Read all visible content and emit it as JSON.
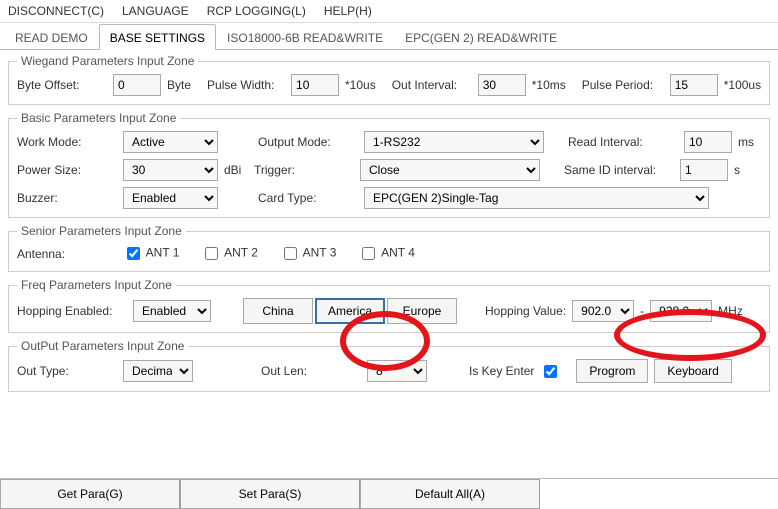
{
  "menu": {
    "disconnect": "DISCONNECT(C)",
    "language": "LANGUAGE",
    "rcplogging": "RCP LOGGING(L)",
    "help": "HELP(H)"
  },
  "tabs": {
    "readdemo": "READ DEMO",
    "basesettings": "BASE SETTINGS",
    "iso": "ISO18000-6B READ&WRITE",
    "epc": "EPC(GEN 2) READ&WRITE"
  },
  "wiegand": {
    "legend": "Wiegand Parameters Input Zone",
    "byteoffset_lbl": "Byte Offset:",
    "byteoffset": "0",
    "byte_unit": "Byte",
    "pulsewidth_lbl": "Pulse Width:",
    "pulsewidth": "10",
    "pw_unit": "*10us",
    "outinterval_lbl": "Out Interval:",
    "outinterval": "30",
    "oi_unit": "*10ms",
    "pulseperiod_lbl": "Pulse Period:",
    "pulseperiod": "15",
    "pp_unit": "*100us"
  },
  "basic": {
    "legend": "Basic Parameters Input Zone",
    "workmode_lbl": "Work Mode:",
    "workmode": "Active",
    "outputmode_lbl": "Output Mode:",
    "outputmode": "1-RS232",
    "readinterval_lbl": "Read Interval:",
    "readinterval": "10",
    "ri_unit": "ms",
    "powersize_lbl": "Power Size:",
    "powersize": "30",
    "dbi": "dBi",
    "trigger_lbl": "Trigger:",
    "trigger": "Close",
    "sameid_lbl": "Same ID interval:",
    "sameid": "1",
    "sid_unit": "s",
    "buzzer_lbl": "Buzzer:",
    "buzzer": "Enabled",
    "cardtype_lbl": "Card Type:",
    "cardtype": "EPC(GEN 2)Single-Tag"
  },
  "senior": {
    "legend": "Senior Parameters Input Zone",
    "antenna_lbl": "Antenna:",
    "ant1": "ANT 1",
    "ant2": "ANT 2",
    "ant3": "ANT 3",
    "ant4": "ANT 4"
  },
  "freq": {
    "legend": "Freq Parameters Input Zone",
    "hopping_lbl": "Hopping Enabled:",
    "hopping": "Enabled",
    "china": "China",
    "america": "America",
    "europe": "Europe",
    "hoppingvalue_lbl": "Hopping Value:",
    "hv_from": "902.0",
    "hv_to": "928.0",
    "dash": "-",
    "mhz": "MHz"
  },
  "output": {
    "legend": "OutPut Parameters Input Zone",
    "outtype_lbl": "Out Type:",
    "outtype": "Decima",
    "outlen_lbl": "Out Len:",
    "outlen": "8",
    "iskey_lbl": "Is Key Enter",
    "program": "Progrom",
    "keyboard": "Keyboard"
  },
  "buttons": {
    "getpara": "Get Para(G)",
    "setpara": "Set Para(S)",
    "defaultall": "Default All(A)"
  }
}
